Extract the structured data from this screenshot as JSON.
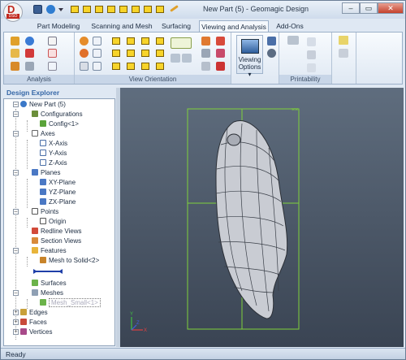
{
  "window": {
    "title": "New Part (5) - Geomagic Design",
    "app_badge": "D",
    "app_badge_sub": "DSO",
    "controls": [
      "–",
      "▭",
      "✕"
    ]
  },
  "menu_tabs": [
    {
      "label": "Part Modeling",
      "active": false
    },
    {
      "label": "Scanning and Mesh",
      "active": false
    },
    {
      "label": "Surfacing",
      "active": false
    },
    {
      "label": "Viewing and Analysis",
      "active": true
    },
    {
      "label": "Add-Ons",
      "active": false
    }
  ],
  "ribbon": {
    "groups": {
      "analysis": "Analysis",
      "view_orientation": "View Orientation",
      "printability": "Printability"
    },
    "viewing_options_line1": "Viewing",
    "viewing_options_line2": "Options ▾"
  },
  "explorer": {
    "title": "Design Explorer",
    "items": [
      {
        "label": "New Part (5)"
      },
      {
        "label": "Configurations"
      },
      {
        "label": "Config<1>"
      },
      {
        "label": "Axes"
      },
      {
        "label": "X-Axis"
      },
      {
        "label": "Y-Axis"
      },
      {
        "label": "Z-Axis"
      },
      {
        "label": "Planes"
      },
      {
        "label": "XY-Plane"
      },
      {
        "label": "YZ-Plane"
      },
      {
        "label": "ZX-Plane"
      },
      {
        "label": "Points"
      },
      {
        "label": "Origin"
      },
      {
        "label": "Redline Views"
      },
      {
        "label": "Section Views"
      },
      {
        "label": "Features"
      },
      {
        "label": "Mesh to Solid<2>"
      },
      {
        "label": "Surfaces"
      },
      {
        "label": "Meshes"
      },
      {
        "label": "Mesh_Small<1>"
      },
      {
        "label": "Edges"
      },
      {
        "label": "Faces"
      },
      {
        "label": "Vertices"
      }
    ]
  },
  "viewport": {
    "triad": {
      "x": "X",
      "y": "Y",
      "z": "Z"
    }
  },
  "status": {
    "text": "Ready"
  },
  "colors": {
    "accent": "#3466a6",
    "selection_green": "#7fd13b",
    "viewport_bg": "#4a5566",
    "feature_yellow": "#f7d42a"
  }
}
